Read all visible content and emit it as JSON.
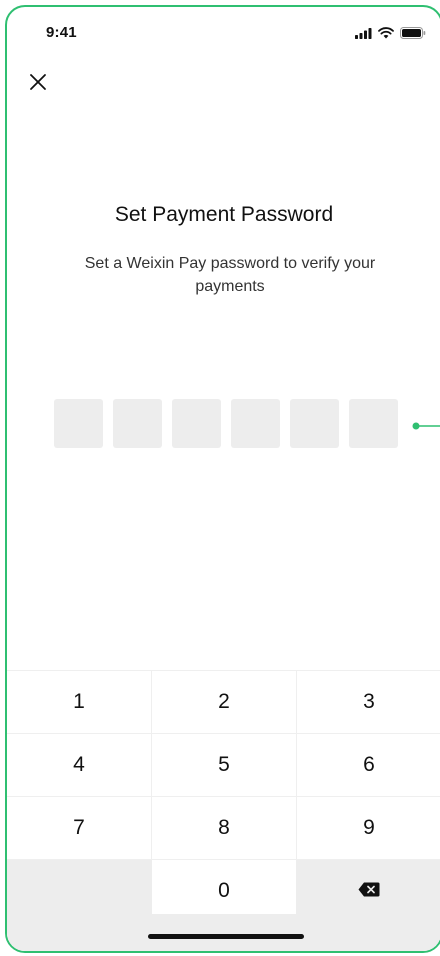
{
  "status_bar": {
    "time": "9:41",
    "icons": [
      "cellular-signal-icon",
      "wifi-icon",
      "battery-icon"
    ]
  },
  "header": {
    "close_icon": "close-icon"
  },
  "main": {
    "title": "Set Payment Password",
    "subtitle": "Set a Weixin Pay password to verify your payments",
    "pin_length": 6
  },
  "keypad": {
    "rows": [
      [
        "1",
        "2",
        "3"
      ],
      [
        "4",
        "5",
        "6"
      ],
      [
        "7",
        "8",
        "9"
      ]
    ],
    "zero": "0",
    "delete_icon": "backspace-icon"
  },
  "colors": {
    "frame_border": "#2fbf71",
    "pin_box": "#ededed",
    "keypad_gray": "#ededed",
    "text": "#111111"
  }
}
